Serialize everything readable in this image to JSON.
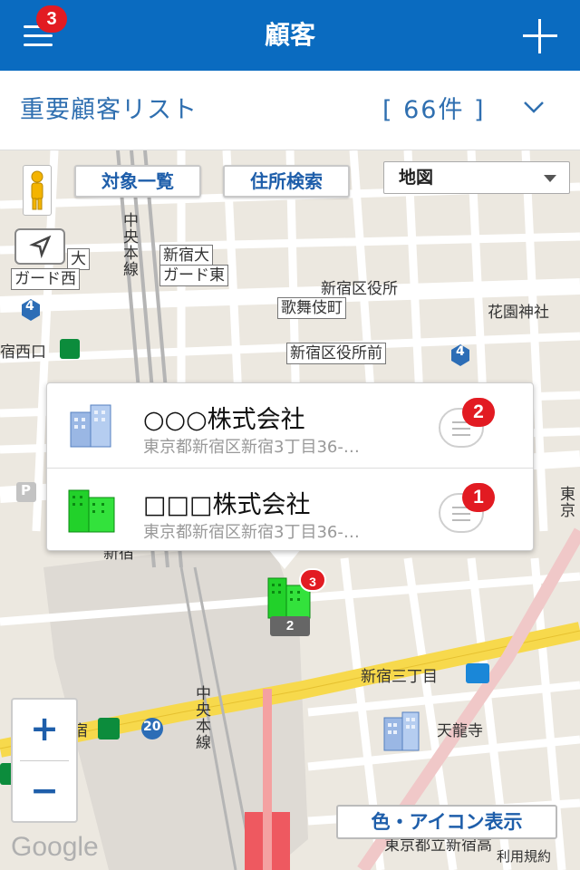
{
  "header": {
    "title": "顧客",
    "menu_badge": "3"
  },
  "list": {
    "name": "重要顧客リスト",
    "count": "[ 66件 ]"
  },
  "map": {
    "buttons": {
      "target_list": "対象一覧",
      "address_search": "住所検索",
      "map_type": "地図",
      "color_icon": "色・アイコン表示",
      "zoom_in": "+",
      "zoom_out": "−"
    },
    "labels": {
      "chuo_line_1": "中央本線",
      "chuo_line_2": "中央本線",
      "shinjuku_guard_east_1": "新宿大",
      "shinjuku_guard_east_2": "ガード東",
      "guard_west_1": "大",
      "guard_west_2": "ガード西",
      "kabukicho": "歌舞伎町",
      "ward_office": "新宿区役所",
      "ward_office_mae": "新宿区役所前",
      "hanazono": "花園神社",
      "nishiguchi": "宿西口",
      "shinjuku": "新宿",
      "sanchome": "新宿三丁目",
      "tenryuji": "天龍寺",
      "route_4a": "4",
      "route_4b": "4",
      "route_20": "20",
      "parking": "P",
      "higashi": "東京",
      "hospital": "東京都立新宿高",
      "station_left": "宿"
    },
    "google": "Google",
    "terms": "利用規約",
    "marker": {
      "badge": "3",
      "count": "2"
    }
  },
  "popup": {
    "items": [
      {
        "name": "○○○株式会社",
        "address": "東京都新宿区新宿3丁目36-…",
        "badge": "2",
        "icon": "building-blue-icon"
      },
      {
        "name": "□□□株式会社",
        "address": "東京都新宿区新宿3丁目36-…",
        "badge": "1",
        "icon": "building-green-icon"
      }
    ]
  },
  "colors": {
    "header_bg": "#0a6bc0",
    "accent": "#2f6fb0",
    "badge": "#e21b22"
  }
}
